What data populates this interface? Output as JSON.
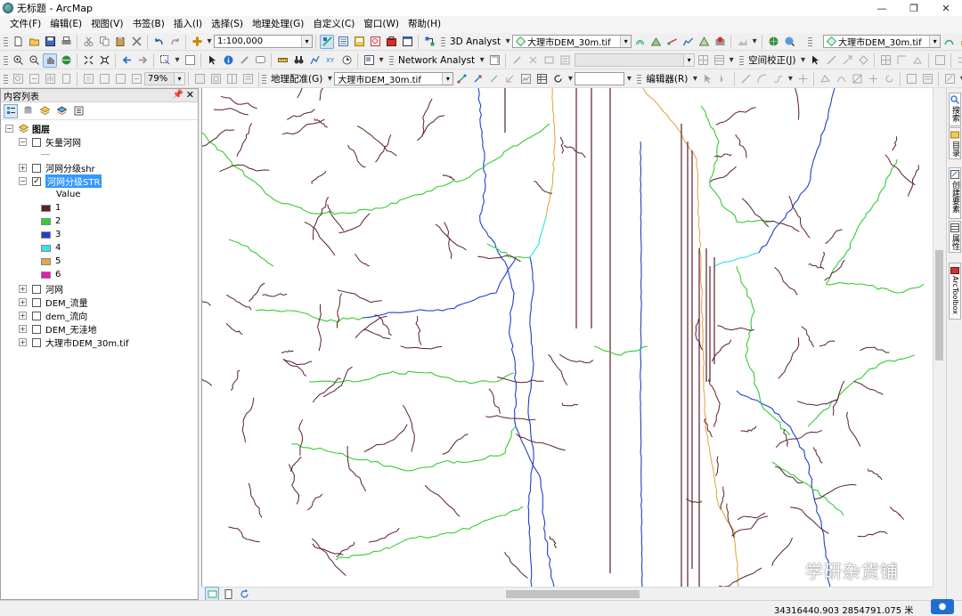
{
  "window": {
    "title": "无标题 - ArcMap",
    "minimize": "—",
    "restore": "❐",
    "close": "✕"
  },
  "menu": [
    "文件(F)",
    "编辑(E)",
    "视图(V)",
    "书签(B)",
    "插入(I)",
    "选择(S)",
    "地理处理(G)",
    "自定义(C)",
    "窗口(W)",
    "帮助(H)"
  ],
  "toolbar1": {
    "scale": "1:100,000",
    "analyst3d_label": "3D Analyst",
    "layer_combo1": "大理市DEM_30m.tif",
    "layer_combo2": "大理市DEM_30m.tif"
  },
  "toolbar2": {
    "network_analyst_label": "Network Analyst",
    "spatial_adjust_label": "空间校正(J)"
  },
  "toolbar3": {
    "zoom": "79%",
    "georef_label": "地理配准(G)",
    "georef_layer": "大理市DEM_30m.tif",
    "editor_label": "编辑器(R)"
  },
  "toc": {
    "title": "内容列表",
    "pin": "ᵖ",
    "close": "✕",
    "root": "图层",
    "layers": [
      {
        "label": "矢量河网",
        "checked": false,
        "expanded": true
      },
      {
        "label": "河网分级shr",
        "checked": false,
        "expanded": false
      },
      {
        "label": "河网分级STR",
        "checked": true,
        "expanded": true,
        "selected": true
      },
      {
        "label": "河网",
        "checked": false,
        "expanded": false
      },
      {
        "label": "DEM_流量",
        "checked": false,
        "expanded": false
      },
      {
        "label": "dem_流向",
        "checked": false,
        "expanded": false
      },
      {
        "label": "DEM_无洼地",
        "checked": false,
        "expanded": false
      },
      {
        "label": "大理市DEM_30m.tif",
        "checked": false,
        "expanded": false
      }
    ],
    "legend_heading": "Value",
    "legend": [
      {
        "label": "1",
        "color": "#5c1f2a"
      },
      {
        "label": "2",
        "color": "#33cc33"
      },
      {
        "label": "3",
        "color": "#1f3fd1"
      },
      {
        "label": "4",
        "color": "#36e3ea"
      },
      {
        "label": "5",
        "color": "#e3a84a"
      },
      {
        "label": "6",
        "color": "#e619b0"
      }
    ]
  },
  "dock_tabs": [
    "搜索",
    "目录",
    "创建要素",
    "属性",
    "ArcToolbox"
  ],
  "status": {
    "coords": "34316440.903  2854791.075 米"
  },
  "watermark": "学研杂货铺",
  "colors": {
    "order1": "#5c1f2a",
    "order2": "#33cc33",
    "order3": "#1f3fd1",
    "order4": "#36e3ea",
    "order5": "#e3a84a",
    "selection": "#3399ff"
  }
}
